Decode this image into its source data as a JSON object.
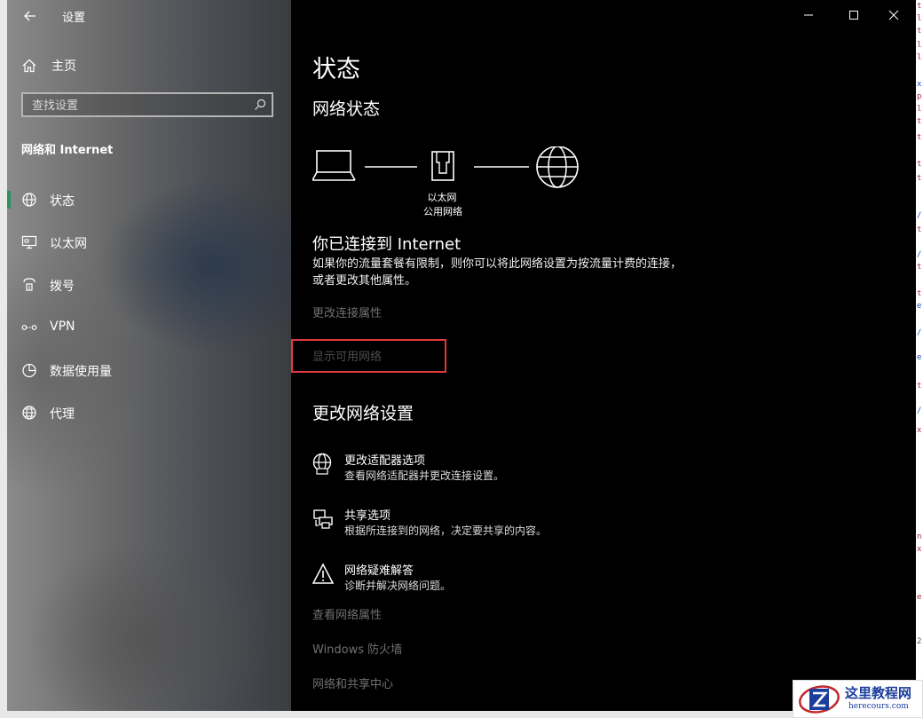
{
  "window": {
    "title": "设置"
  },
  "sidebar": {
    "home_label": "主页",
    "search_placeholder": "查找设置",
    "section_title": "网络和 Internet",
    "items": [
      {
        "label": "状态",
        "icon": "globe-status-icon",
        "selected": true
      },
      {
        "label": "以太网",
        "icon": "ethernet-monitor-icon"
      },
      {
        "label": "拨号",
        "icon": "phone-dialup-icon"
      },
      {
        "label": "VPN",
        "icon": "vpn-icon"
      },
      {
        "label": "数据使用量",
        "icon": "data-usage-pie-icon"
      },
      {
        "label": "代理",
        "icon": "globe-proxy-icon"
      }
    ],
    "accent_color": "#2d8f5e"
  },
  "main": {
    "page_title": "状态",
    "network_status_heading": "网络状态",
    "diagram": {
      "adapter_label": "以太网",
      "network_type": "公用网络"
    },
    "connected_heading": "你已连接到 Internet",
    "connected_desc": "如果你的流量套餐有限制，则你可以将此网络设置为按流量计费的连接，或者更改其他属性。",
    "links": {
      "change_connection_props": "更改连接属性",
      "show_available_networks": "显示可用网络"
    },
    "change_settings_heading": "更改网络设置",
    "options": [
      {
        "title": "更改适配器选项",
        "desc": "查看网络适配器并更改连接设置。",
        "icon": "adapter-globe-icon"
      },
      {
        "title": "共享选项",
        "desc": "根据所连接到的网络，决定要共享的内容。",
        "icon": "sharing-printer-icon"
      },
      {
        "title": "网络疑难解答",
        "desc": "诊断并解决网络问题。",
        "icon": "warning-triangle-icon"
      }
    ],
    "bottom_links": [
      "查看网络属性",
      "Windows 防火墙",
      "网络和共享中心"
    ]
  },
  "watermark": {
    "title": "这里教程网",
    "url": "herecours.com"
  }
}
